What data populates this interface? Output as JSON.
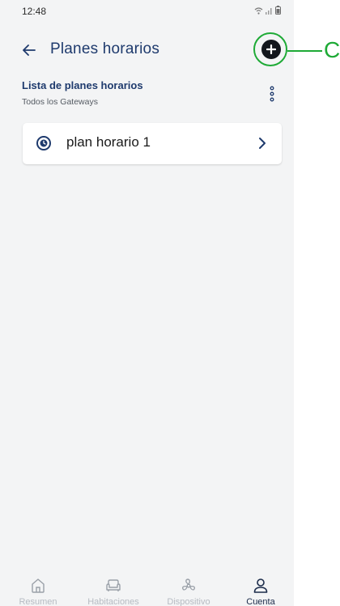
{
  "status_bar": {
    "time": "12:48",
    "icons": [
      "wifi-icon",
      "signal-icon",
      "battery-icon"
    ]
  },
  "app_bar": {
    "back_icon": "arrow-left-icon",
    "title": "Planes horarios",
    "add_icon": "plus-circle-icon"
  },
  "section": {
    "title": "Lista de planes horarios",
    "subtitle": "Todos los Gateways",
    "more_icon": "more-vertical-icon"
  },
  "plans": [
    {
      "label": "plan horario 1",
      "icon": "clock-icon",
      "action_icon": "chevron-right-icon"
    }
  ],
  "bottom_nav": {
    "items": [
      {
        "label": "Resumen",
        "icon": "home-icon",
        "active": false
      },
      {
        "label": "Habitaciones",
        "icon": "sofa-icon",
        "active": false
      },
      {
        "label": "Dispositivo",
        "icon": "fan-icon",
        "active": false
      },
      {
        "label": "Cuenta",
        "icon": "person-icon",
        "active": true
      }
    ]
  },
  "annotation": {
    "letter": "C",
    "color": "#1eaa36"
  },
  "colors": {
    "primary": "#1e3a6d",
    "background": "#f3f4f5",
    "card": "#ffffff",
    "inactive_nav": "#b6bbc2",
    "annotation": "#1eaa36"
  }
}
